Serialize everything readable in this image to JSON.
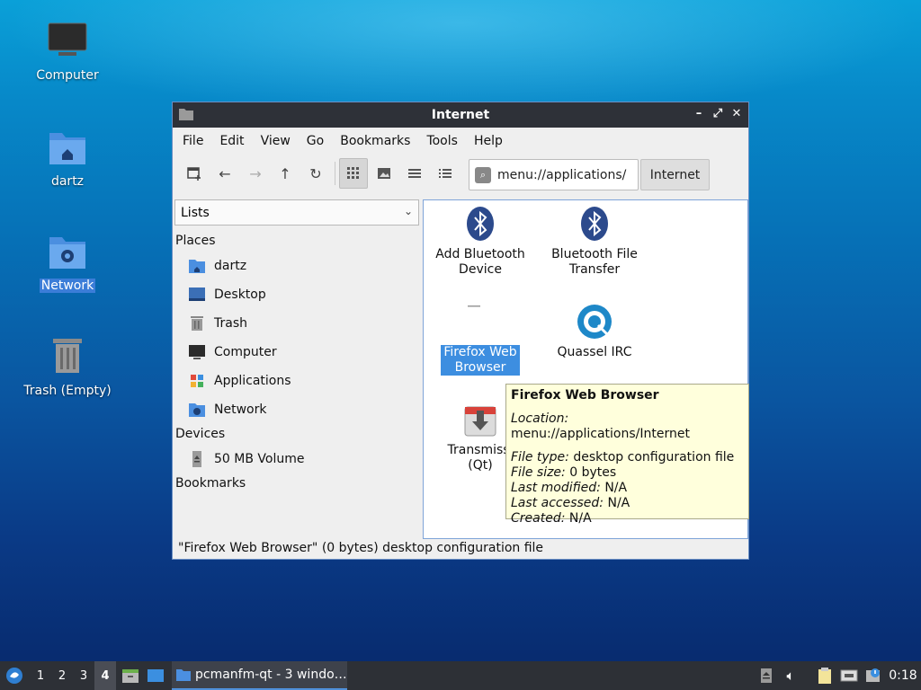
{
  "desktop": {
    "icons": [
      {
        "label": "Computer",
        "icon": "monitor-icon"
      },
      {
        "label": "dartz",
        "icon": "home-folder-icon"
      },
      {
        "label": "Network",
        "icon": "network-folder-icon",
        "selected": true
      },
      {
        "label": "Trash (Empty)",
        "icon": "trash-icon"
      }
    ]
  },
  "window": {
    "title": "Internet",
    "menu": [
      "File",
      "Edit",
      "View",
      "Go",
      "Bookmarks",
      "Tools",
      "Help"
    ],
    "address": "menu://applications/",
    "breadcrumb": "Internet",
    "sidebar": {
      "mode": "Lists",
      "places_header": "Places",
      "places": [
        {
          "label": "dartz",
          "icon": "home-folder-icon"
        },
        {
          "label": "Desktop",
          "icon": "desktop-icon"
        },
        {
          "label": "Trash",
          "icon": "trash-icon"
        },
        {
          "label": "Computer",
          "icon": "monitor-icon"
        },
        {
          "label": "Applications",
          "icon": "applications-icon"
        },
        {
          "label": "Network",
          "icon": "network-folder-icon"
        }
      ],
      "devices_header": "Devices",
      "devices": [
        {
          "label": "50 MB Volume",
          "icon": "eject-icon"
        }
      ],
      "bookmarks_header": "Bookmarks"
    },
    "files": [
      {
        "line1": "Add Bluetooth",
        "line2": "Device",
        "icon": "bluetooth-icon"
      },
      {
        "line1": "Bluetooth File",
        "line2": "Transfer",
        "icon": "bluetooth-icon"
      },
      {
        "line1": "Firefox Web",
        "line2": "Browser",
        "icon": "firefox-icon",
        "selected": true
      },
      {
        "line1": "Quassel IRC",
        "line2": "",
        "icon": "quassel-icon"
      },
      {
        "line1": "Transmissi",
        "line2": "(Qt)",
        "icon": "transmission-icon"
      }
    ],
    "tooltip": {
      "title": "Firefox Web Browser",
      "location_label": "Location:",
      "location": "menu://applications/Internet",
      "filetype_label": "File type:",
      "filetype": "desktop configuration file",
      "filesize_label": "File size:",
      "filesize": "0 bytes",
      "modified_label": "Last modified:",
      "modified": "N/A",
      "accessed_label": "Last accessed:",
      "accessed": "N/A",
      "created_label": "Created:",
      "created": "N/A"
    },
    "status": "\"Firefox Web Browser\" (0 bytes) desktop configuration file"
  },
  "taskbar": {
    "workspaces": [
      "1",
      "2",
      "3",
      "4"
    ],
    "current_workspace": "4",
    "task_label": "pcmanfm-qt - 3 windo…",
    "clock": "0:18"
  },
  "colors": {
    "accent": "#3d8ee0",
    "titlebar": "#2e3138",
    "taskbar": "#2d3036",
    "tooltip": "#ffffdc"
  }
}
